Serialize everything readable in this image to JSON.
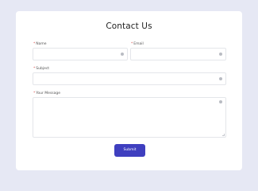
{
  "form": {
    "title": "Contact Us",
    "required_marker": "*",
    "fields": {
      "name": {
        "label": "Name",
        "value": ""
      },
      "email": {
        "label": "Email",
        "value": ""
      },
      "subject": {
        "label": "Subject",
        "value": ""
      },
      "message": {
        "label": "Your Message",
        "value": ""
      }
    },
    "submit_label": "Submit"
  },
  "colors": {
    "page_background": "#e6e8f4",
    "card_background": "#ffffff",
    "accent": "#3f3fbf",
    "required": "#d9534f"
  },
  "icons": {
    "field_status": "info-circle-icon",
    "resize": "resize-grip-icon"
  }
}
